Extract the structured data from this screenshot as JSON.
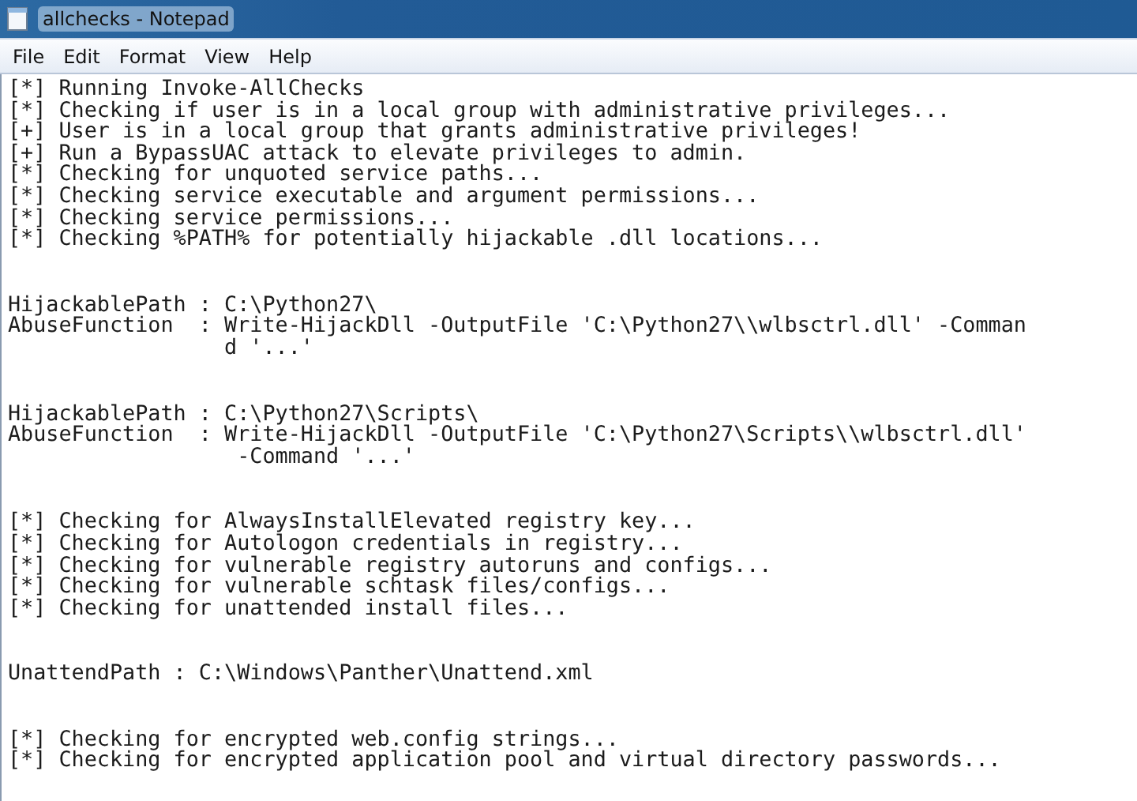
{
  "window": {
    "title": "allchecks - Notepad"
  },
  "menu": [
    "File",
    "Edit",
    "Format",
    "View",
    "Help"
  ],
  "document": {
    "blocks": [
      {
        "lines": [
          "[*] Running Invoke-AllChecks",
          "[*] Checking if user is in a local group with administrative privileges...",
          "[+] User is in a local group that grants administrative privileges!",
          "[+] Run a BypassUAC attack to elevate privileges to admin.",
          "[*] Checking for unquoted service paths...",
          "[*] Checking service executable and argument permissions...",
          "[*] Checking service permissions...",
          "[*] Checking %PATH% for potentially hijackable .dll locations..."
        ]
      },
      {
        "lines": [
          "HijackablePath : C:\\Python27\\",
          "AbuseFunction  : Write-HijackDll -OutputFile 'C:\\Python27\\\\wlbsctrl.dll' -Comman",
          "                 d '...'"
        ]
      },
      {
        "lines": [
          "HijackablePath : C:\\Python27\\Scripts\\",
          "AbuseFunction  : Write-HijackDll -OutputFile 'C:\\Python27\\Scripts\\\\wlbsctrl.dll'",
          "                  -Command '...'"
        ]
      },
      {
        "lines": [
          "[*] Checking for AlwaysInstallElevated registry key...",
          "[*] Checking for Autologon credentials in registry...",
          "[*] Checking for vulnerable registry autoruns and configs...",
          "[*] Checking for vulnerable schtask files/configs...",
          "[*] Checking for unattended install files..."
        ]
      },
      {
        "lines": [
          "UnattendPath : C:\\Windows\\Panther\\Unattend.xml"
        ]
      },
      {
        "lines": [
          "[*] Checking for encrypted web.config strings...",
          "[*] Checking for encrypted application pool and virtual directory passwords..."
        ]
      }
    ]
  }
}
